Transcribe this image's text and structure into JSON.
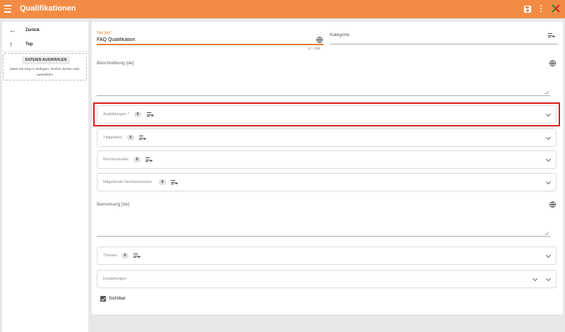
{
  "app": {
    "title": "Qualifikationen",
    "brand_color": "#f28c44",
    "icons": [
      "menu-icon",
      "save-icon",
      "more-vert-icon",
      "logo-icon"
    ]
  },
  "sidebar": {
    "back_label": "Zurück",
    "top_label": "Top",
    "upload_button": "DATEIEN AUSWÄHLEN",
    "upload_hint": "Datei mit Strg+V einfügen, hierher ziehen oder auswählen"
  },
  "form": {
    "title_label": "Titel [de]*",
    "title_value": "FAQ Qualifikation",
    "title_counter": "17 / 250",
    "category_label": "Kategorie",
    "description_label": "Beschreibung [de]",
    "remark_label": "Bemerkung [de]",
    "visible_label": "Sichtbar",
    "visible_checked": true
  },
  "sections": [
    {
      "label": "Ausbildungen *",
      "count": "0"
    },
    {
      "label": "Tätigkeiten",
      "count": "0"
    },
    {
      "label": "Rechtsverweis",
      "count": "0"
    },
    {
      "label": "Mitgeltende Rechtsverweise",
      "count": "0"
    },
    {
      "label": "Themen",
      "count": "0"
    },
    {
      "label": "Einstellungen"
    }
  ],
  "highlight_color": "#d91c1c",
  "accent_color": "#e57a2e"
}
